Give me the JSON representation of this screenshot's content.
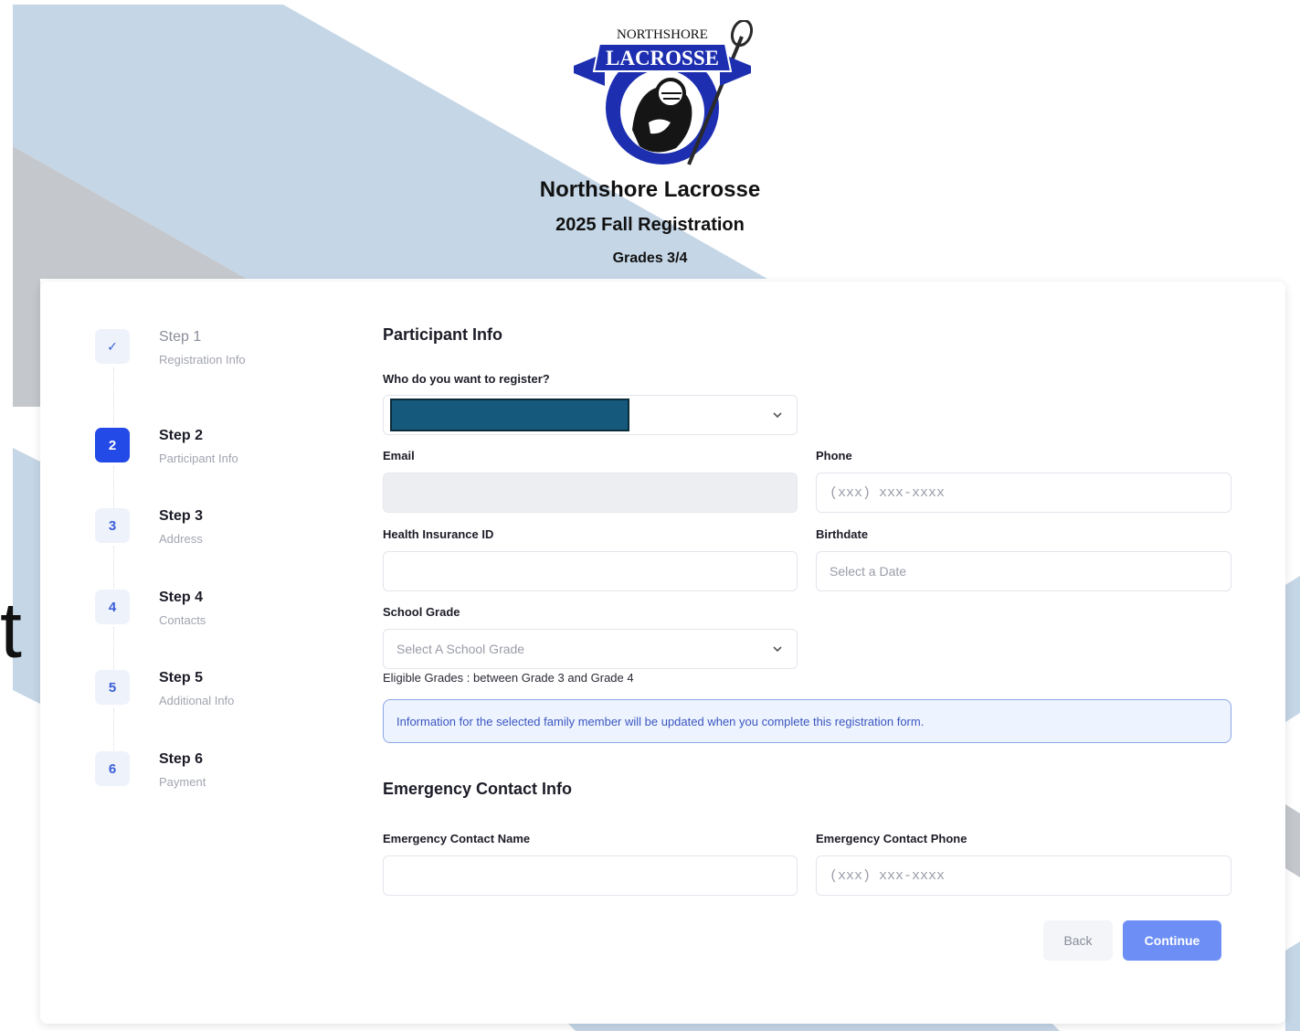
{
  "header": {
    "logo_top_text": "NORTHSHORE",
    "logo_banner_text": "LACROSSE",
    "org_name": "Northshore Lacrosse",
    "registration_title": "2025 Fall Registration",
    "grades": "Grades 3/4"
  },
  "stray_text": "t",
  "steps": [
    {
      "badge": "✓",
      "title": "Step 1",
      "subtitle": "Registration Info",
      "state": "done"
    },
    {
      "badge": "2",
      "title": "Step 2",
      "subtitle": "Participant Info",
      "state": "active"
    },
    {
      "badge": "3",
      "title": "Step 3",
      "subtitle": "Address",
      "state": "pending"
    },
    {
      "badge": "4",
      "title": "Step 4",
      "subtitle": "Contacts",
      "state": "pending"
    },
    {
      "badge": "5",
      "title": "Step 5",
      "subtitle": "Additional Info",
      "state": "pending"
    },
    {
      "badge": "6",
      "title": "Step 6",
      "subtitle": "Payment",
      "state": "pending"
    }
  ],
  "participant": {
    "section_title": "Participant Info",
    "who_label": "Who do you want to register?",
    "email_label": "Email",
    "phone_label": "Phone",
    "phone_placeholder": "(xxx) xxx-xxxx",
    "insurance_label": "Health Insurance ID",
    "birthdate_label": "Birthdate",
    "birthdate_placeholder": "Select a Date",
    "grade_label": "School Grade",
    "grade_placeholder": "Select A School Grade",
    "eligible_text": "Eligible Grades : between Grade 3 and Grade 4",
    "info_text": "Information for the selected family member will be updated when you complete this registration form."
  },
  "emergency": {
    "section_title": "Emergency Contact Info",
    "name_label": "Emergency Contact Name",
    "phone_label": "Emergency Contact Phone",
    "phone_placeholder": "(xxx) xxx-xxxx"
  },
  "actions": {
    "back_label": "Back",
    "continue_label": "Continue"
  },
  "colors": {
    "accent": "#2349e6",
    "continue_button": "#6d8ff5",
    "background_stripe_blue": "#c5d6e6",
    "background_stripe_gray": "#c4c7cc",
    "redaction": "#155a7c"
  }
}
